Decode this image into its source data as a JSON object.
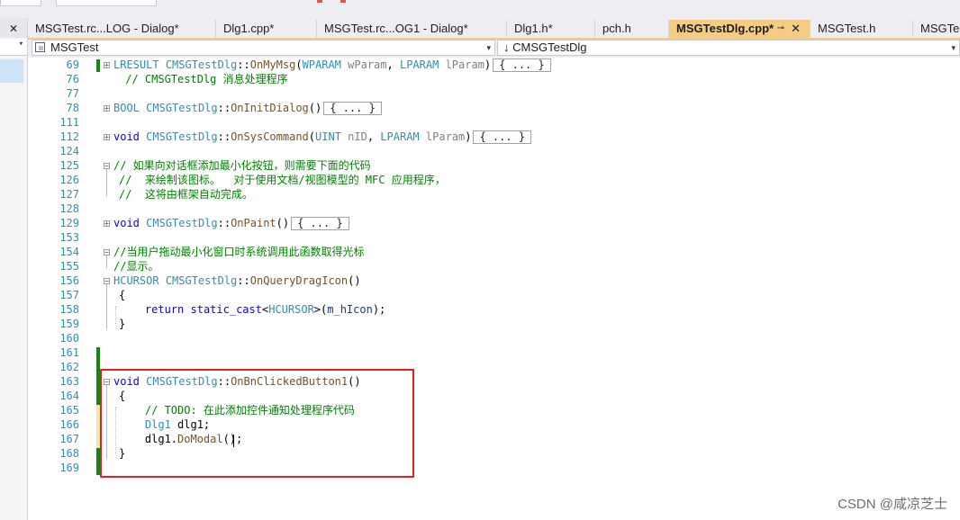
{
  "left_panel": {
    "close_glyph": "✕",
    "dropdown_arrow": "▾"
  },
  "tabs": [
    {
      "label": "MSGTest.rc...LOG - Dialog*",
      "active": false
    },
    {
      "label": "Dlg1.cpp*",
      "active": false
    },
    {
      "label": "MSGTest.rc...OG1 - Dialog*",
      "active": false
    },
    {
      "label": "Dlg1.h*",
      "active": false
    },
    {
      "label": "pch.h",
      "active": false
    },
    {
      "label": "MSGTestDlg.cpp*",
      "active": true,
      "pin": "⊸",
      "close": "✕"
    },
    {
      "label": "MSGTest.h",
      "active": false
    },
    {
      "label": "MSGTe",
      "active": false
    }
  ],
  "nav": {
    "project_combo": "MSGTest",
    "class_combo": "CMSGTestDlg",
    "class_icon": "↓",
    "arrow": "▾"
  },
  "code_lines": {
    "l69": {
      "num": "69",
      "html": "<span class=\"ty\">LRESULT</span> <span class=\"ty\">CMSGTestDlg</span>::<span class=\"fn\">OnMyMsg</span>(<span class=\"ty\">WPARAM</span> <span class=\"pm\">wParam</span>, <span class=\"ty\">LPARAM</span> <span class=\"pm\">lParam</span>)<span class=\"collapse-box\">{ ... }</span>"
    },
    "l76": {
      "num": "76",
      "html": " <span class=\"cm\">// CMSGTestDlg 消息处理程序</span>"
    },
    "l77": {
      "num": "77",
      "html": ""
    },
    "l78": {
      "num": "78",
      "html": "<span class=\"ty\">BOOL</span> <span class=\"ty\">CMSGTestDlg</span>::<span class=\"fn\">OnInitDialog</span>()<span class=\"collapse-box\">{ ... }</span>"
    },
    "l111": {
      "num": "111",
      "html": ""
    },
    "l112": {
      "num": "112",
      "html": "<span class=\"kw\">void</span> <span class=\"ty\">CMSGTestDlg</span>::<span class=\"fn\">OnSysCommand</span>(<span class=\"ty\">UINT</span> <span class=\"pm\">nID</span>, <span class=\"ty\">LPARAM</span> <span class=\"pm\">lParam</span>)<span class=\"collapse-box\">{ ... }</span>"
    },
    "l124": {
      "num": "124",
      "html": ""
    },
    "l125": {
      "num": "125",
      "html": "<span class=\"cm\">// 如果向对话框添加最小化按钮，则需要下面的代码</span>"
    },
    "l126": {
      "num": "126",
      "html": "<span class=\"cm\">//  来绘制该图标。  对于使用文档/视图模型的 MFC 应用程序，</span>"
    },
    "l127": {
      "num": "127",
      "html": "<span class=\"cm\">//  这将由框架自动完成。</span>"
    },
    "l128": {
      "num": "128",
      "html": ""
    },
    "l129": {
      "num": "129",
      "html": "<span class=\"kw\">void</span> <span class=\"ty\">CMSGTestDlg</span>::<span class=\"fn\">OnPaint</span>()<span class=\"collapse-box\">{ ... }</span>"
    },
    "l153": {
      "num": "153",
      "html": ""
    },
    "l154": {
      "num": "154",
      "html": "<span class=\"cm\">//当用户拖动最小化窗口时系统调用此函数取得光标</span>"
    },
    "l155": {
      "num": "155",
      "html": "<span class=\"cm\">//显示。</span>"
    },
    "l156": {
      "num": "156",
      "html": "<span class=\"ty\">HCURSOR</span> <span class=\"ty\">CMSGTestDlg</span>::<span class=\"fn\">OnQueryDragIcon</span>()"
    },
    "l157": {
      "num": "157",
      "html": "{"
    },
    "l158": {
      "num": "158",
      "html": "    <span class=\"kw\">return</span> <span class=\"kw\">static_cast</span>&lt;<span class=\"ty\">HCURSOR</span>&gt;(<span class=\"mb\">m_hIcon</span>);"
    },
    "l159": {
      "num": "159",
      "html": "}"
    },
    "l160": {
      "num": "160",
      "html": ""
    },
    "l161": {
      "num": "161",
      "html": ""
    },
    "l162": {
      "num": "162",
      "html": ""
    },
    "l163": {
      "num": "163",
      "html": "<span class=\"kw\">void</span> <span class=\"ty\">CMSGTestDlg</span>::<span class=\"fn\">OnBnClickedButton1</span>()"
    },
    "l164": {
      "num": "164",
      "html": "{"
    },
    "l165": {
      "num": "165",
      "html": "    <span class=\"cm\">// TODO: 在此添加控件通知处理程序代码</span>"
    },
    "l166": {
      "num": "166",
      "html": "    <span class=\"ty\">Dlg1</span> dlg1;"
    },
    "l167": {
      "num": "167",
      "html": "    dlg1.<span class=\"fn\">DoModal</span>();"
    },
    "l168": {
      "num": "168",
      "html": "}"
    },
    "l169": {
      "num": "169",
      "html": ""
    }
  },
  "watermark": "CSDN @咸凉芝士"
}
